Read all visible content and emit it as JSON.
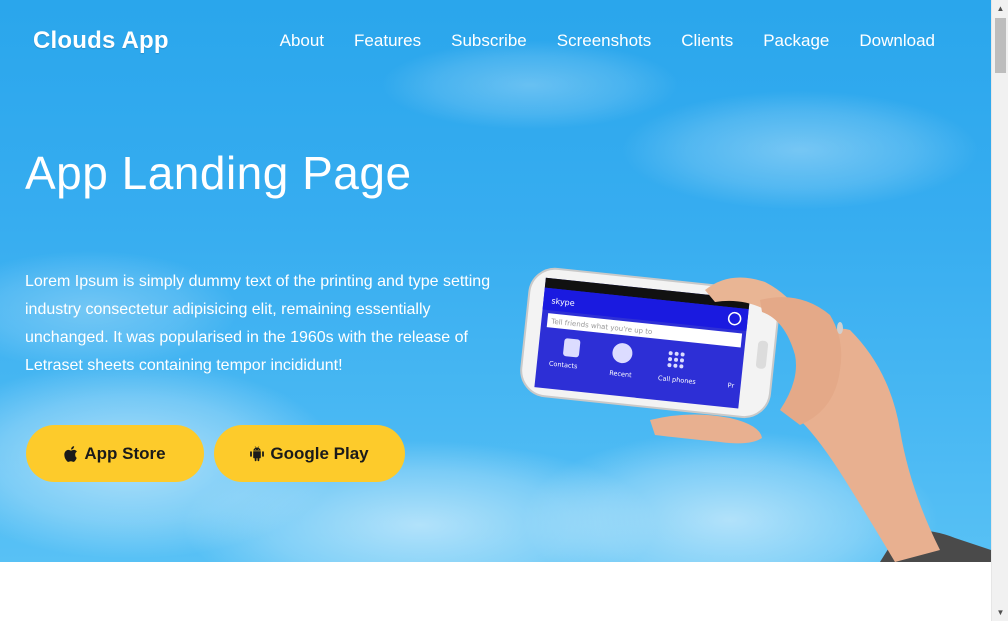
{
  "brand": "Clouds App",
  "nav": [
    "About",
    "Features",
    "Subscribe",
    "Screenshots",
    "Clients",
    "Package",
    "Download"
  ],
  "hero": {
    "title": "App Landing Page",
    "lead": "Lorem Ipsum is simply dummy text of the printing and type setting industry consectetur adipisicing elit, remaining essentially unchanged. It was popularised in the 1960s with the release of Letraset sheets containing tempor incididunt!",
    "buttons": {
      "app_store": "App Store",
      "google_play": "Google Play"
    }
  },
  "phone_screen": {
    "app_logo": "skype",
    "search_placeholder": "Tell friends what you're up to",
    "shortcuts": [
      "Contacts",
      "Recent",
      "Call phones",
      "Pr"
    ]
  },
  "icons": {
    "app_store_button": "apple-icon",
    "google_play_button": "android-icon"
  },
  "colors": {
    "sky": "#37adf0",
    "button": "#fdcb2b",
    "text": "#ffffff"
  }
}
